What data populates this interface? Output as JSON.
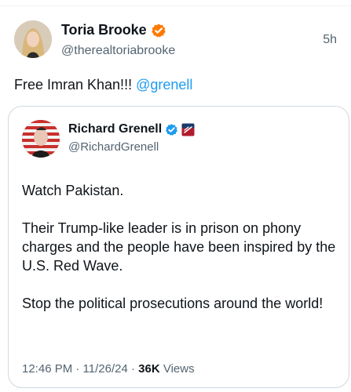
{
  "post": {
    "display_name": "Toria Brooke",
    "handle": "@therealtoriabrooke",
    "time": "5h",
    "text": "Free Imran Khan!!! ",
    "mention": "@grenell"
  },
  "quote": {
    "display_name": "Richard Grenell",
    "handle": "@RichardGrenell",
    "paragraphs": [
      "Watch Pakistan.",
      "Their Trump-like leader is in prison on phony charges and the people have been inspired by the U.S. Red Wave.",
      "Stop the political prosecutions around the world!"
    ],
    "timestamp": "12:46 PM · 11/26/24 · ",
    "views_count": "36K",
    "views_label": " Views"
  },
  "colors": {
    "accent": "#1d9bf0",
    "badge_orange": "#ff7a00",
    "text_secondary": "#536471"
  },
  "icons": {
    "verified_orange": "verified-badge-icon",
    "verified_blue": "verified-badge-icon",
    "affiliate": "affiliate-badge-icon"
  }
}
